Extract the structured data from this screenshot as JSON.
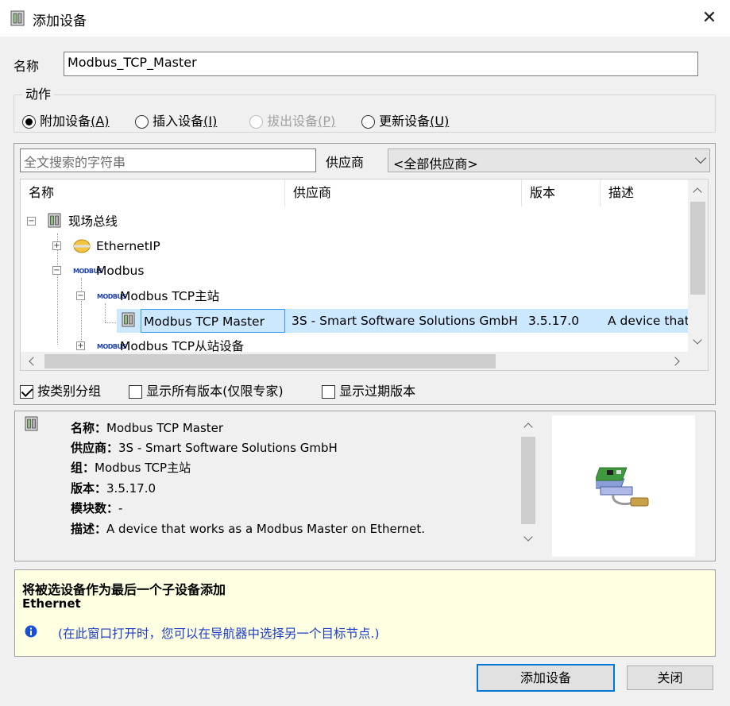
{
  "window": {
    "title": "添加设备",
    "close_icon": "close-icon"
  },
  "name_field": {
    "label": "名称",
    "value": "Modbus_TCP_Master"
  },
  "action_group": {
    "label": "动作",
    "options": [
      {
        "label": "附加设备",
        "hotkey": "(A)",
        "checked": true,
        "enabled": true
      },
      {
        "label": "插入设备",
        "hotkey": "(I)",
        "checked": false,
        "enabled": true
      },
      {
        "label": "拔出设备",
        "hotkey": "(P)",
        "checked": false,
        "enabled": false
      },
      {
        "label": "更新设备",
        "hotkey": "(U)",
        "checked": false,
        "enabled": true
      }
    ]
  },
  "search": {
    "placeholder": "全文搜索的字符串",
    "vendor_label": "供应商",
    "vendor_selected": "<全部供应商>"
  },
  "device_tree": {
    "columns": [
      "名称",
      "供应商",
      "版本",
      "描述"
    ],
    "nodes": [
      {
        "label": "现场总线",
        "icon": "device-icon",
        "expanded": true
      },
      {
        "label": "EthernetIP",
        "icon": "ethernetip-icon",
        "expanded": false
      },
      {
        "label": "Modbus",
        "icon": "modbus-icon",
        "expanded": true
      },
      {
        "label": "Modbus TCP主站",
        "icon": "modbus-icon",
        "expanded": true
      },
      {
        "label": "Modbus TCP Master",
        "icon": "device-icon",
        "selected": true,
        "vendor": "3S - Smart Software Solutions GmbH",
        "version": "3.5.17.0",
        "description": "A device that"
      },
      {
        "label": "Modbus TCP从站设备",
        "icon": "modbus-icon",
        "expanded": false
      }
    ],
    "modbus_icon_text": "MODBUS"
  },
  "options": {
    "group_by_category": {
      "label": "按类别分组",
      "checked": true
    },
    "show_all_versions": {
      "label": "显示所有版本(仅限专家)",
      "checked": false
    },
    "show_outdated": {
      "label": "显示过期版本",
      "checked": false
    }
  },
  "info": {
    "name_key": "名称：",
    "name_val": "Modbus TCP Master",
    "vendor_key": "供应商：",
    "vendor_val": "3S - Smart Software Solutions GmbH",
    "group_key": "组：",
    "group_val": "Modbus TCP主站",
    "version_key": "版本：",
    "version_val": "3.5.17.0",
    "modules_key": "模块数：",
    "modules_val": "-",
    "desc_key": "描述：",
    "desc_val": "A device that works as a Modbus Master on Ethernet."
  },
  "hint": {
    "title": "将被选设备作为最后一个子设备添加",
    "subtitle": "Ethernet",
    "note": "(在此窗口打开时，您可以在导航器中选择另一个目标节点.)",
    "note_icon": "info-icon"
  },
  "buttons": {
    "add": "添加设备",
    "close": "关闭"
  }
}
